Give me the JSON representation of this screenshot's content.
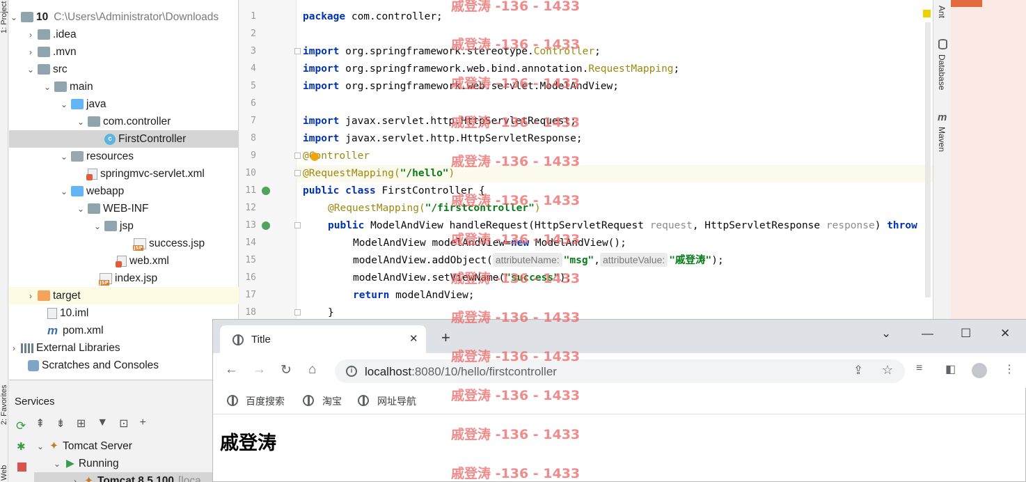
{
  "left_stripe": {
    "project_label": "1: Project",
    "favorites_label": "2: Favorites",
    "web_label": "Web"
  },
  "project_tree": {
    "root_name": "10",
    "root_path": "C:\\Users\\Administrator\\Downloads",
    "idea": ".idea",
    "mvn": ".mvn",
    "src": "src",
    "main": "main",
    "java": "java",
    "package": "com.controller",
    "controller_class": "FirstController",
    "resources": "resources",
    "springmvc_xml": "springmvc-servlet.xml",
    "webapp": "webapp",
    "webinf": "WEB-INF",
    "jsp": "jsp",
    "success_jsp": "success.jsp",
    "web_xml": "web.xml",
    "index_jsp": "index.jsp",
    "target": "target",
    "iml": "10.iml",
    "pom": "pom.xml",
    "external_libraries": "External Libraries",
    "scratches": "Scratches and Consoles"
  },
  "services": {
    "title": "Services",
    "tomcat_server": "Tomcat Server",
    "running": "Running",
    "tomcat_instance": "Tomcat 8.5.100",
    "tomcat_instance_suffix": "[loca"
  },
  "editor": {
    "line_numbers": [
      "1",
      "2",
      "3",
      "4",
      "5",
      "6",
      "7",
      "8",
      "9",
      "10",
      "11",
      "12",
      "13",
      "14",
      "15",
      "16",
      "17",
      "18"
    ],
    "l1_kw": "package",
    "l1_rest": " com.controller;",
    "l3_kw": "import",
    "l3_rest": " org.springframework.stereotype.",
    "l3_ann": "Controller",
    "l3_end": ";",
    "l4_kw": "import",
    "l4_rest": " org.springframework.web.bind.annotation.",
    "l4_ann": "RequestMapping",
    "l4_end": ";",
    "l5_kw": "import",
    "l5_rest": " org.springframework.web.servlet.ModelAndView;",
    "l7_kw": "import",
    "l7_rest": " javax.servlet.http.HttpServletRequest;",
    "l8_kw": "import",
    "l8_rest": " javax.servlet.http.HttpServletResponse;",
    "l9_ann": "@Controller",
    "l10_ann": "@RequestMapping(",
    "l10_str": "\"/hello\"",
    "l10_end": ")",
    "l11_kw1": "public",
    "l11_kw2": "class",
    "l11_rest": " FirstController {",
    "l12_ann": "@RequestMapping(",
    "l12_str": "\"/firstcontroller\"",
    "l12_end": ")",
    "l13_kw": "public",
    "l13_rest": " ModelAndView handleRequest(HttpServletRequest ",
    "l13_p1": "request",
    "l13_mid": ", HttpServletResponse ",
    "l13_p2": "response",
    "l13_end": ") ",
    "l13_kw2": "throw",
    "l14_rest": "ModelAndView modelAndView=",
    "l14_kw": "new",
    "l14_end": " ModelAndView();",
    "l15_rest": "modelAndView.addObject(",
    "l15_hint1": "attributeName:",
    "l15_str1": "\"msg\"",
    "l15_comma": ",",
    "l15_hint2": "attributeValue:",
    "l15_str2": "\"戚登涛\"",
    "l15_end": ");",
    "l16_rest": "modelAndView.setViewName(",
    "l16_str": "\"success\"",
    "l16_end": ");",
    "l17_kw": "return",
    "l17_rest": " modelAndView;",
    "l18_rest": "}"
  },
  "right_stripe": {
    "ant": "Ant",
    "database": "Database",
    "maven": "Maven"
  },
  "browser": {
    "tab_title": "Title",
    "new_tab": "+",
    "url_domain": "localhost",
    "url_rest": ":8080/10/hello/firstcontroller",
    "bookmarks": [
      "百度搜索",
      "淘宝",
      "网址导航"
    ],
    "page_heading": "戚登涛"
  },
  "watermark": {
    "text": "戚登涛 -136 - 1433"
  },
  "colors": {
    "keyword": "#0033b3",
    "annotation": "#9e880d",
    "string": "#067d17",
    "selection": "#d5d5d5"
  }
}
